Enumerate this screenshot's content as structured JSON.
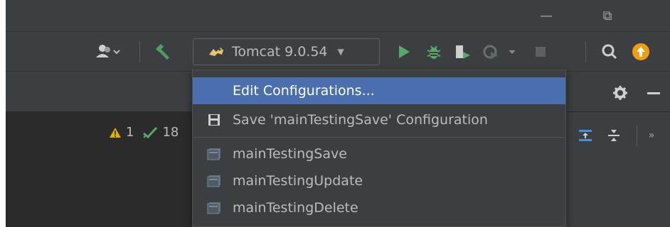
{
  "window": {
    "minimize_glyph": "—",
    "restore_glyph": "⧉"
  },
  "toolbar": {
    "run_config_label": "Tomcat 9.0.54",
    "icons": [
      "user-icon",
      "build-hammer-icon",
      "tomcat-icon",
      "run-icon",
      "debug-icon",
      "coverage-icon",
      "profile-icon",
      "stop-icon",
      "search-icon",
      "update-icon"
    ]
  },
  "inspection": {
    "warnings": "1",
    "checks": "18"
  },
  "dropdown": {
    "items": [
      {
        "label": "Edit Configurations...",
        "icon": "",
        "selected": true
      },
      {
        "label": "Save 'mainTestingSave' Configuration",
        "icon": "save-icon"
      },
      {
        "label": "mainTestingSave",
        "icon": "application-config-icon"
      },
      {
        "label": "mainTestingUpdate",
        "icon": "application-config-icon"
      },
      {
        "label": "mainTestingDelete",
        "icon": "application-config-icon"
      }
    ]
  },
  "colors": {
    "accent_run": "#59a869",
    "accent_build": "#4fa05e",
    "selection": "#4b6eaf",
    "warning": "#e0b000",
    "update": "#f39c12"
  }
}
